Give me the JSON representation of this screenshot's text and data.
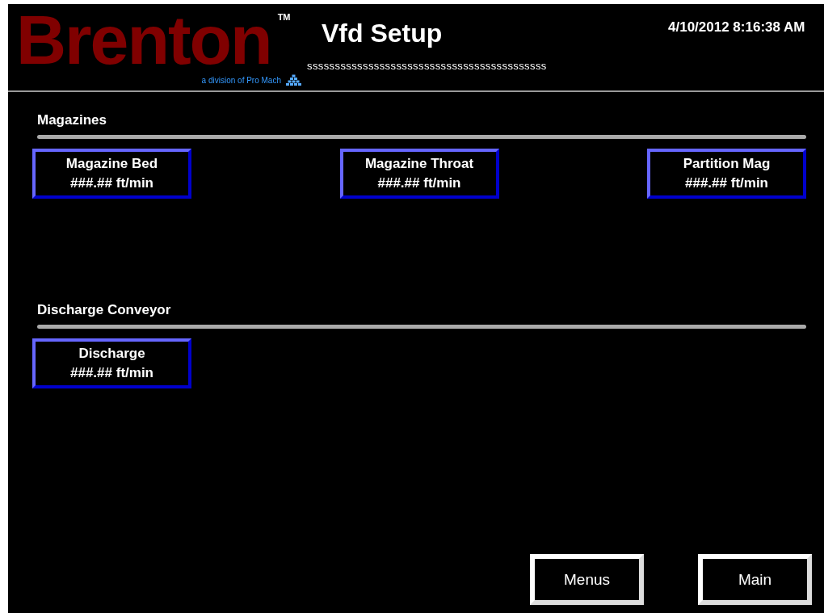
{
  "header": {
    "logo": {
      "name": "Brenton",
      "trademark": "TM",
      "tagline": "a division of Pro Mach"
    },
    "title": "Vfd Setup",
    "subtitle": "sssssssssssssssssssssssssssssssssssssssssss",
    "datetime": "4/10/2012 8:16:38 AM"
  },
  "sections": [
    {
      "title": "Magazines",
      "buttons": [
        {
          "label": "Magazine Bed",
          "value": "###.## ft/min"
        },
        {
          "label": "Magazine Throat",
          "value": "###.## ft/min"
        },
        {
          "label": "Partition Mag",
          "value": "###.## ft/min"
        }
      ]
    },
    {
      "title": "Discharge Conveyor",
      "buttons": [
        {
          "label": "Discharge",
          "value": "###.## ft/min"
        }
      ]
    }
  ],
  "nav_buttons": [
    "Menus",
    "Main"
  ]
}
